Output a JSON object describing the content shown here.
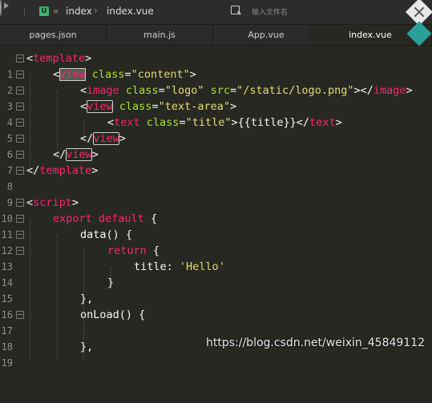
{
  "toolbar": {
    "breadcrumb_project": "index",
    "breadcrumb_file": "index.vue",
    "search_placeholder": "输入文件名",
    "icons": [
      "play-icon",
      "u-badge",
      "back-arrows-icon",
      "search-icon",
      "menu-icon"
    ]
  },
  "tabs": [
    {
      "label": "pages.json",
      "active": false
    },
    {
      "label": "main.js",
      "active": false
    },
    {
      "label": "App.vue",
      "active": false
    },
    {
      "label": "index.vue",
      "active": true
    }
  ],
  "code_lines": [
    {
      "num": "1"
    },
    {
      "num": "2"
    },
    {
      "num": "3"
    },
    {
      "num": "4"
    },
    {
      "num": "5"
    },
    {
      "num": "6"
    },
    {
      "num": "7"
    },
    {
      "num": "8"
    },
    {
      "num": "9"
    },
    {
      "num": "10"
    },
    {
      "num": "11"
    },
    {
      "num": "12"
    },
    {
      "num": "13"
    },
    {
      "num": "14"
    },
    {
      "num": "15"
    },
    {
      "num": "16"
    },
    {
      "num": "17"
    },
    {
      "num": "18"
    },
    {
      "num": "19"
    }
  ],
  "code": {
    "template": "template",
    "view": "view",
    "image": "image",
    "text": "text",
    "script": "script",
    "attr_class": "class",
    "attr_src": "src",
    "val_content": "\"content\"",
    "val_logo": "\"logo\"",
    "val_src": "\"/static/logo.png\"",
    "val_textarea": "\"text-area\"",
    "val_title": "\"title\"",
    "mustache": "{{title}}",
    "kw_export": "export",
    "kw_default": "default",
    "kw_return": "return",
    "data_fn": "data() {",
    "title_key": "title:",
    "title_val": "'Hello'",
    "onload_fn": "onLoad() {"
  },
  "watermark": "https://blog.csdn.net/weixin_45849112"
}
